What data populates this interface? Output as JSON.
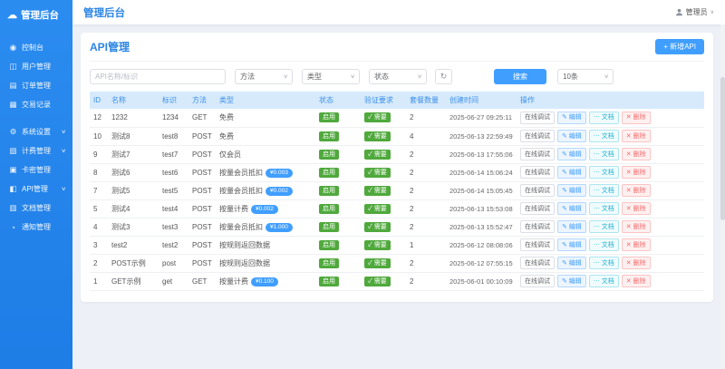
{
  "brand": {
    "logo_text": "管理后台",
    "logo_icon_glyph": "☁"
  },
  "header": {
    "title": "管理后台",
    "user_name": "管理员",
    "dropdown_arrow": "∨"
  },
  "sidebar": {
    "chevron": "∨",
    "items": [
      {
        "label": "控制台",
        "icon": "dashboard-icon",
        "glyph": "◉",
        "expandable": false,
        "group_gap": false
      },
      {
        "label": "用户管理",
        "icon": "users-icon",
        "glyph": "◫",
        "expandable": false,
        "group_gap": false
      },
      {
        "label": "订单管理",
        "icon": "orders-icon",
        "glyph": "▤",
        "expandable": false,
        "group_gap": false
      },
      {
        "label": "交易记录",
        "icon": "records-icon",
        "glyph": "▦",
        "expandable": false,
        "group_gap": false
      },
      {
        "label": "系统设置",
        "icon": "settings-icon",
        "glyph": "⚙",
        "expandable": true,
        "group_gap": true
      },
      {
        "label": "计费管理",
        "icon": "billing-icon",
        "glyph": "▧",
        "expandable": true,
        "group_gap": false
      },
      {
        "label": "卡密管理",
        "icon": "card-icon",
        "glyph": "▣",
        "expandable": false,
        "group_gap": false
      },
      {
        "label": "API管理",
        "icon": "api-icon",
        "glyph": "◧",
        "expandable": true,
        "group_gap": false
      },
      {
        "label": "文档管理",
        "icon": "docs-icon",
        "glyph": "▥",
        "expandable": false,
        "group_gap": false
      },
      {
        "label": "通知管理",
        "icon": "bell-icon",
        "glyph": "◔",
        "expandable": false,
        "group_gap": false
      }
    ]
  },
  "page": {
    "title": "API管理",
    "add_button": "+ 新增API",
    "filters": {
      "search_placeholder": "API名称/标识",
      "method_select": "方法",
      "type_select": "类型",
      "status_select": "状态",
      "reset_icon_glyph": "↻",
      "search_button": "搜索",
      "page_size": "10条"
    },
    "table": {
      "columns": [
        "ID",
        "名称",
        "标识",
        "方法",
        "类型",
        "状态",
        "验证要求",
        "套餐数量",
        "创建时间",
        "操作"
      ],
      "status_label": "启用",
      "verify_check": "✓",
      "verify_label": "需要",
      "actions": [
        {
          "label": "在线调试",
          "icon": "",
          "style": "default",
          "name": "debug-action-button"
        },
        {
          "label": "编辑",
          "icon": "✎",
          "style": "primary",
          "name": "edit-action-button"
        },
        {
          "label": "文档",
          "icon": "⋯",
          "style": "info",
          "name": "doc-action-button"
        },
        {
          "label": "删除",
          "icon": "✕",
          "style": "danger",
          "name": "delete-action-button"
        }
      ],
      "rows": [
        {
          "id": "12",
          "name": "1232",
          "key": "1234",
          "method": "GET",
          "type": "免费",
          "price": "",
          "plans": "2",
          "created": "2025-06-27 09:25:11"
        },
        {
          "id": "10",
          "name": "测试8",
          "key": "test8",
          "method": "POST",
          "type": "免费",
          "price": "",
          "plans": "4",
          "created": "2025-06-13 22:59:49"
        },
        {
          "id": "9",
          "name": "测试7",
          "key": "test7",
          "method": "POST",
          "type": "仅会员",
          "price": "",
          "plans": "2",
          "created": "2025-06-13 17:55:06"
        },
        {
          "id": "8",
          "name": "测试6",
          "key": "test6",
          "method": "POST",
          "type": "按量会员抵扣",
          "price": "¥0.003",
          "plans": "2",
          "created": "2025-06-14 15:06:24"
        },
        {
          "id": "7",
          "name": "测试5",
          "key": "test5",
          "method": "POST",
          "type": "按量会员抵扣",
          "price": "¥0.002",
          "plans": "2",
          "created": "2025-06-14 15:05:45"
        },
        {
          "id": "5",
          "name": "测试4",
          "key": "test4",
          "method": "POST",
          "type": "按量计费",
          "price": "¥0.002",
          "plans": "2",
          "created": "2025-06-13 15:53:08"
        },
        {
          "id": "4",
          "name": "测试3",
          "key": "test3",
          "method": "POST",
          "type": "按量会员抵扣",
          "price": "¥1.000",
          "plans": "2",
          "created": "2025-06-13 15:52:47"
        },
        {
          "id": "3",
          "name": "test2",
          "key": "test2",
          "method": "POST",
          "type": "按规则返回数据",
          "price": "",
          "plans": "1",
          "created": "2025-06-12 08:08:06"
        },
        {
          "id": "2",
          "name": "POST示例",
          "key": "post",
          "method": "POST",
          "type": "按规则返回数据",
          "price": "",
          "plans": "2",
          "created": "2025-06-12 07:55:15"
        },
        {
          "id": "1",
          "name": "GET示例",
          "key": "get",
          "method": "GET",
          "type": "按量计费",
          "price": "¥0.100",
          "plans": "2",
          "created": "2025-06-01 00:10:09"
        }
      ]
    }
  },
  "colors": {
    "primary": "#409eff",
    "sidebar_blue": "#2487ec",
    "title_blue": "#2b85e4",
    "success_green": "#4fa93c",
    "danger_red": "#f56c6c",
    "table_header_bg": "#d6eafc"
  }
}
